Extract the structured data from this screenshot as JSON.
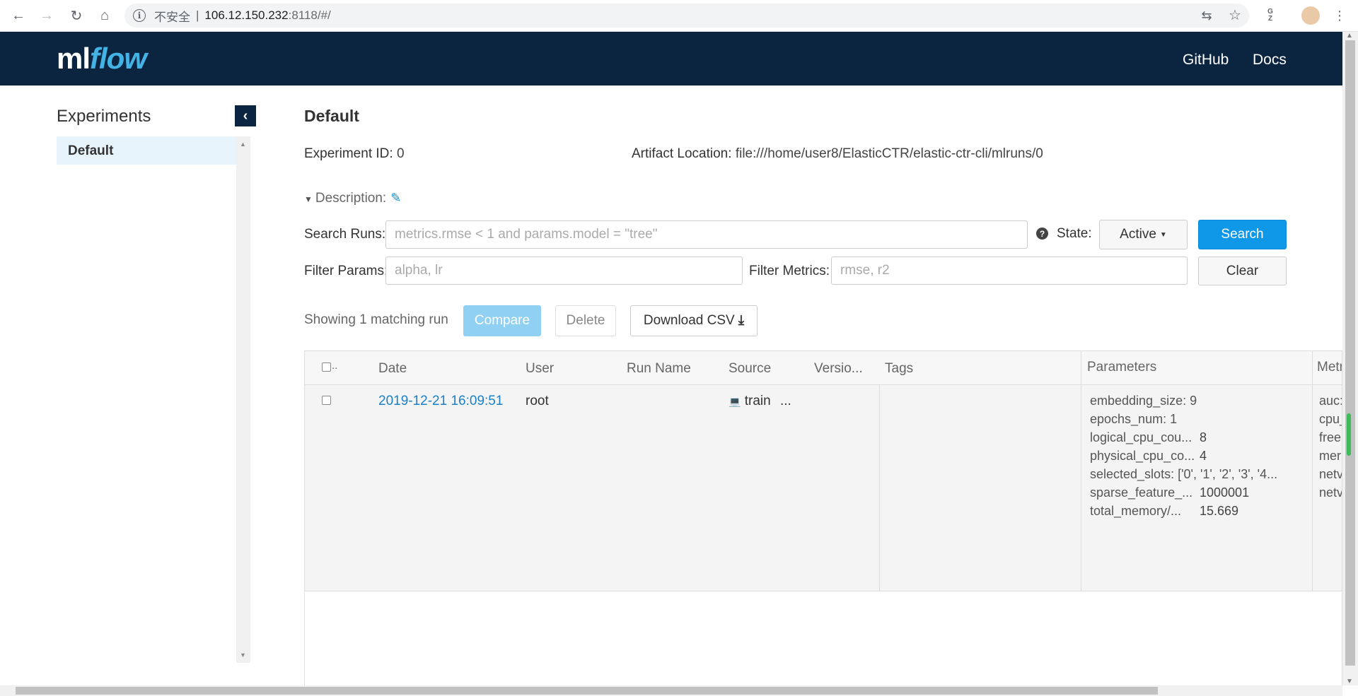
{
  "browser": {
    "insecure_label": "不安全",
    "separator": "|",
    "host": "106.12.150.232",
    "path": ":8118/#/"
  },
  "header": {
    "logo_ml": "ml",
    "logo_flow": "flow",
    "github": "GitHub",
    "docs": "Docs"
  },
  "sidebar": {
    "title": "Experiments",
    "items": [
      {
        "label": "Default"
      }
    ]
  },
  "experiment": {
    "title": "Default",
    "id_label": "Experiment ID:",
    "id_value": "0",
    "artifact_label": "Artifact Location:",
    "artifact_value": "file:///home/user8/ElasticCTR/elastic-ctr-cli/mlruns/0",
    "description_label": "Description:"
  },
  "search": {
    "runs_label": "Search Runs:",
    "runs_placeholder": "metrics.rmse < 1 and params.model = \"tree\"",
    "state_label": "State:",
    "state_value": "Active",
    "search_button": "Search",
    "filter_params_label": "Filter Params:",
    "filter_params_placeholder": "alpha, lr",
    "filter_metrics_label": "Filter Metrics:",
    "filter_metrics_placeholder": "rmse, r2",
    "clear_button": "Clear"
  },
  "runs": {
    "showing": "Showing 1 matching run",
    "compare": "Compare",
    "delete": "Delete",
    "download_csv": "Download CSV"
  },
  "table": {
    "headers": {
      "check": "..",
      "date": "Date",
      "user": "User",
      "run_name": "Run Name",
      "source": "Source",
      "version": "Versio...",
      "tags": "Tags",
      "parameters": "Parameters",
      "metrics": "Metri"
    },
    "row": {
      "date": "2019-12-21 16:09:51",
      "user": "root",
      "source": "train",
      "source_more": "...",
      "params": [
        {
          "key": "embedding_size:",
          "value": "9"
        },
        {
          "key": "epochs_num:",
          "value": "1"
        },
        {
          "key": "logical_cpu_cou...",
          "value": "8"
        },
        {
          "key": "physical_cpu_co...",
          "value": "4"
        },
        {
          "key": "selected_slots:",
          "value": "['0', '1', '2', '3', '4..."
        },
        {
          "key": "sparse_feature_...",
          "value": "1000001"
        },
        {
          "key": "total_memory/...",
          "value": "15.669"
        }
      ],
      "metrics": [
        "auc:",
        "cpu_",
        "free",
        "mer",
        "netv",
        "netv"
      ]
    }
  }
}
